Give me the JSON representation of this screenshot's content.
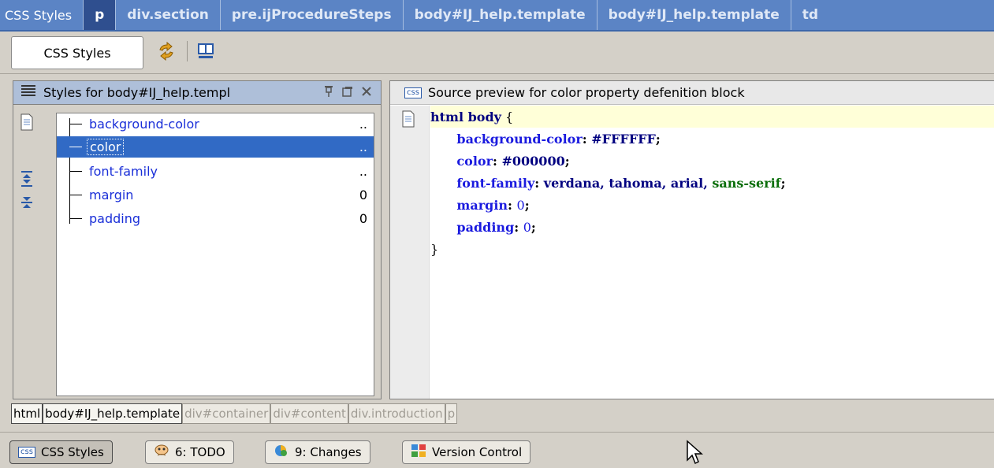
{
  "editor_tabs": [
    "CSS Styles",
    "p",
    "div.section",
    "pre.ijProcedureSteps",
    "body#IJ_help.template",
    "body#IJ_help.template",
    "td"
  ],
  "toolbar": {
    "tab_label": "CSS Styles",
    "icons": [
      "refresh-icon",
      "layout-icon"
    ]
  },
  "styles_panel": {
    "title": "Styles for body#IJ_help.templ",
    "properties": [
      {
        "name": "background-color",
        "value": ".."
      },
      {
        "name": "color",
        "value": "..",
        "selected": true
      },
      {
        "name": "font-family",
        "value": ".."
      },
      {
        "name": "margin",
        "value": "0"
      },
      {
        "name": "padding",
        "value": "0"
      }
    ]
  },
  "source_panel": {
    "title": "Source preview for color property defenition block",
    "header_icon": "css",
    "selector": "html body",
    "declarations": [
      {
        "property": "background-color",
        "value": "#FFFFFF"
      },
      {
        "property": "color",
        "value": "#000000"
      },
      {
        "property": "font-family",
        "value": "verdana, tahoma, arial, ",
        "value_generic": "sans-serif"
      },
      {
        "property": "margin",
        "value": "0"
      },
      {
        "property": "padding",
        "value": "0"
      }
    ]
  },
  "breadcrumbs": [
    "html",
    "body#IJ_help.template",
    "div#container",
    "div#content",
    "div.introduction",
    "p"
  ],
  "tool_windows": [
    {
      "label": "CSS Styles",
      "icon": "css",
      "active": true
    },
    {
      "label": "6: TODO",
      "icon": "todo-icon"
    },
    {
      "label": "9: Changes",
      "icon": "changes-icon"
    },
    {
      "label": "Version Control",
      "icon": "vcs-icon"
    }
  ],
  "colors": {
    "tab_bar": "#5b84c5",
    "selection": "#316ac5",
    "property_blue": "#1a2fd8",
    "caret_line": "#ffffd8"
  }
}
